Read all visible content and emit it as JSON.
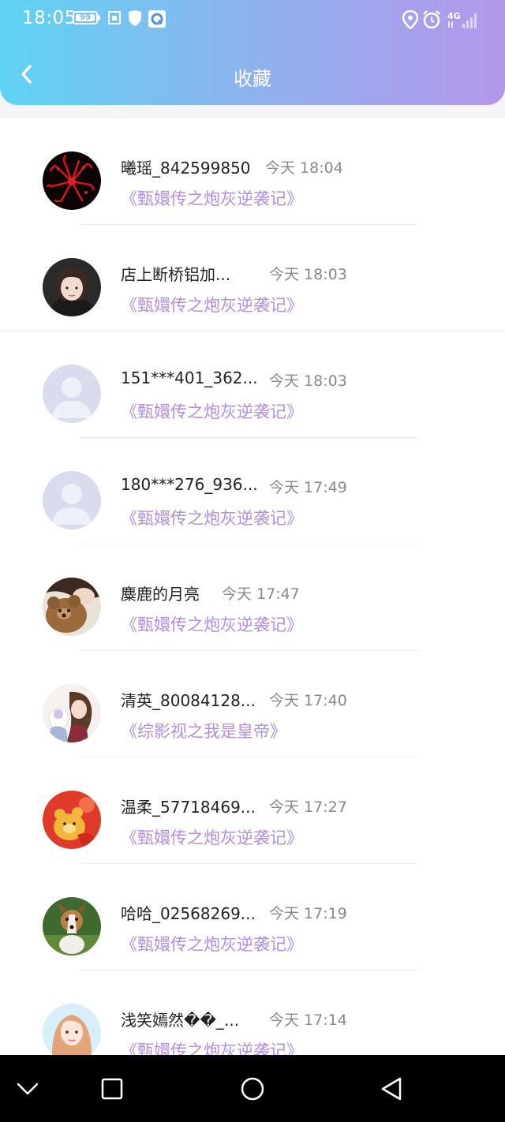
{
  "status_bar": {
    "time": "18:05",
    "battery": "99",
    "icons": [
      "gallery-icon",
      "shield-icon",
      "q-app-icon",
      "location-icon",
      "alarm-icon",
      "signal-4g-icon"
    ]
  },
  "header": {
    "title": "收藏",
    "back_icon": "chevron-left-icon"
  },
  "colors": {
    "accent": "#b18ee0",
    "header_start": "#5fd3f2",
    "header_end": "#b497ea"
  },
  "favorites": [
    {
      "username": "曦瑶_842599850",
      "time": "今天 18:04",
      "book": "《甄嬛传之炮灰逆袭记》",
      "avatar": "red-flower"
    },
    {
      "username": "店上断桥铝加...",
      "time": "今天 18:03",
      "book": "《甄嬛传之炮灰逆袭记》",
      "avatar": "girl-portrait"
    },
    {
      "username": "151***401_362...",
      "time": "今天 18:03",
      "book": "《甄嬛传之炮灰逆袭记》",
      "avatar": "default-user"
    },
    {
      "username": "180***276_936...",
      "time": "今天 17:49",
      "book": "《甄嬛传之炮灰逆袭记》",
      "avatar": "default-user"
    },
    {
      "username": "麋鹿的月亮",
      "time": "今天 17:47",
      "book": "《甄嬛传之炮灰逆袭记》",
      "avatar": "teddy-bear"
    },
    {
      "username": "清英_80084128...",
      "time": "今天 17:40",
      "book": "《综影视之我是皇帝》",
      "avatar": "anime-couple"
    },
    {
      "username": "温柔_57718469...",
      "time": "今天 17:27",
      "book": "《甄嬛传之炮灰逆袭记》",
      "avatar": "cartoon-bear"
    },
    {
      "username": "哈哈_02568269...",
      "time": "今天 17:19",
      "book": "《甄嬛传之炮灰逆袭记》",
      "avatar": "dog"
    },
    {
      "username": "浅笑嫣然��_...",
      "time": "今天 17:14",
      "book": "《甄嬛传之炮灰逆袭记》",
      "avatar": "girl-photo"
    }
  ],
  "nav_bar": {
    "icons": [
      "chevron-down-icon",
      "recents-icon",
      "home-icon",
      "back-triangle-icon"
    ]
  }
}
